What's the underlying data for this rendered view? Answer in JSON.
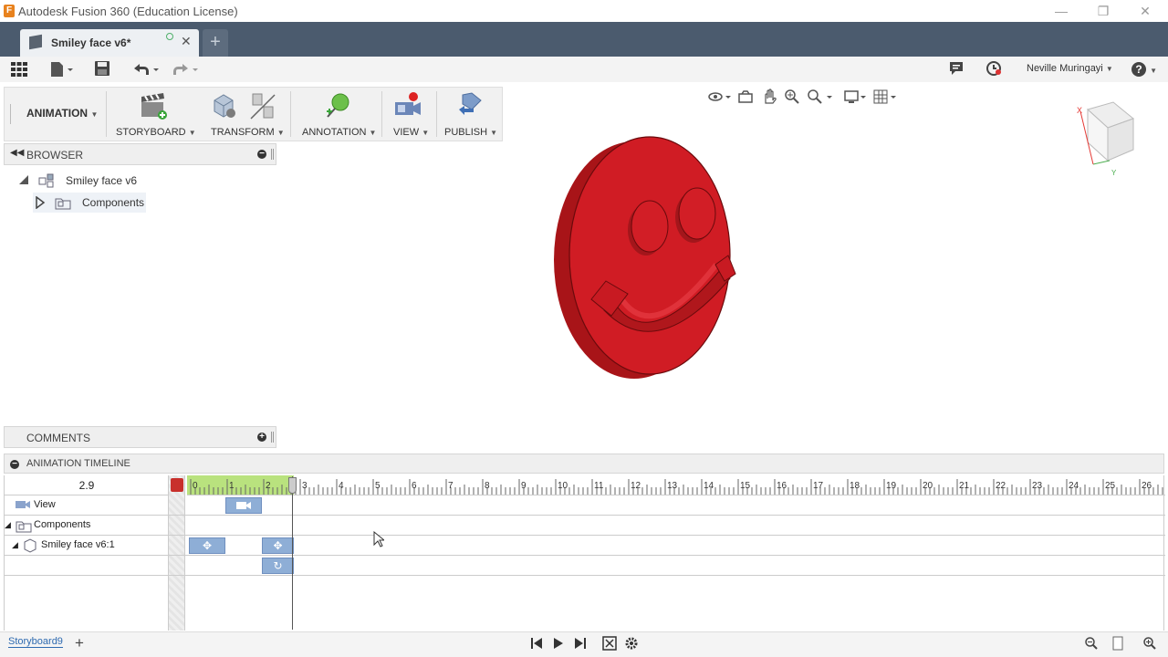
{
  "window": {
    "title": "Autodesk Fusion 360 (Education License)",
    "logo": "F",
    "minimize": "—",
    "restore": "❐",
    "close": "✕"
  },
  "tabs": {
    "active_tab": "Smiley face v6*",
    "close": "✕",
    "new_tab": "+"
  },
  "qat": {
    "user": "Neville Muringayi",
    "help": "?"
  },
  "toolbar": {
    "workspace": "ANIMATION",
    "groups": [
      {
        "label": "STORYBOARD"
      },
      {
        "label": "TRANSFORM"
      },
      {
        "label": "ANNOTATION"
      },
      {
        "label": "VIEW"
      },
      {
        "label": "PUBLISH"
      }
    ]
  },
  "browser": {
    "title": "BROWSER",
    "root": "Smiley face v6",
    "child": "Components"
  },
  "comments": {
    "title": "COMMENTS"
  },
  "timeline": {
    "title": "ANIMATION TIMELINE",
    "current_time": "2.9",
    "ticks": [
      "0",
      "1",
      "2",
      "3",
      "4",
      "5",
      "6",
      "7",
      "8",
      "9",
      "10",
      "11",
      "12",
      "13",
      "14",
      "15",
      "16",
      "17",
      "18",
      "19",
      "20",
      "21",
      "22",
      "23",
      "24",
      "25",
      "26"
    ],
    "rows": [
      {
        "label": "View"
      },
      {
        "label": "Components"
      },
      {
        "label": "Smiley face v6:1"
      }
    ]
  },
  "bottombar": {
    "storyboard": "Storyboard9",
    "add": "+"
  },
  "colors": {
    "model": "#d01c24",
    "tabbar": "#4b5b6e",
    "clip": "#8eaed6",
    "ruler_active": "#b9e27e"
  }
}
